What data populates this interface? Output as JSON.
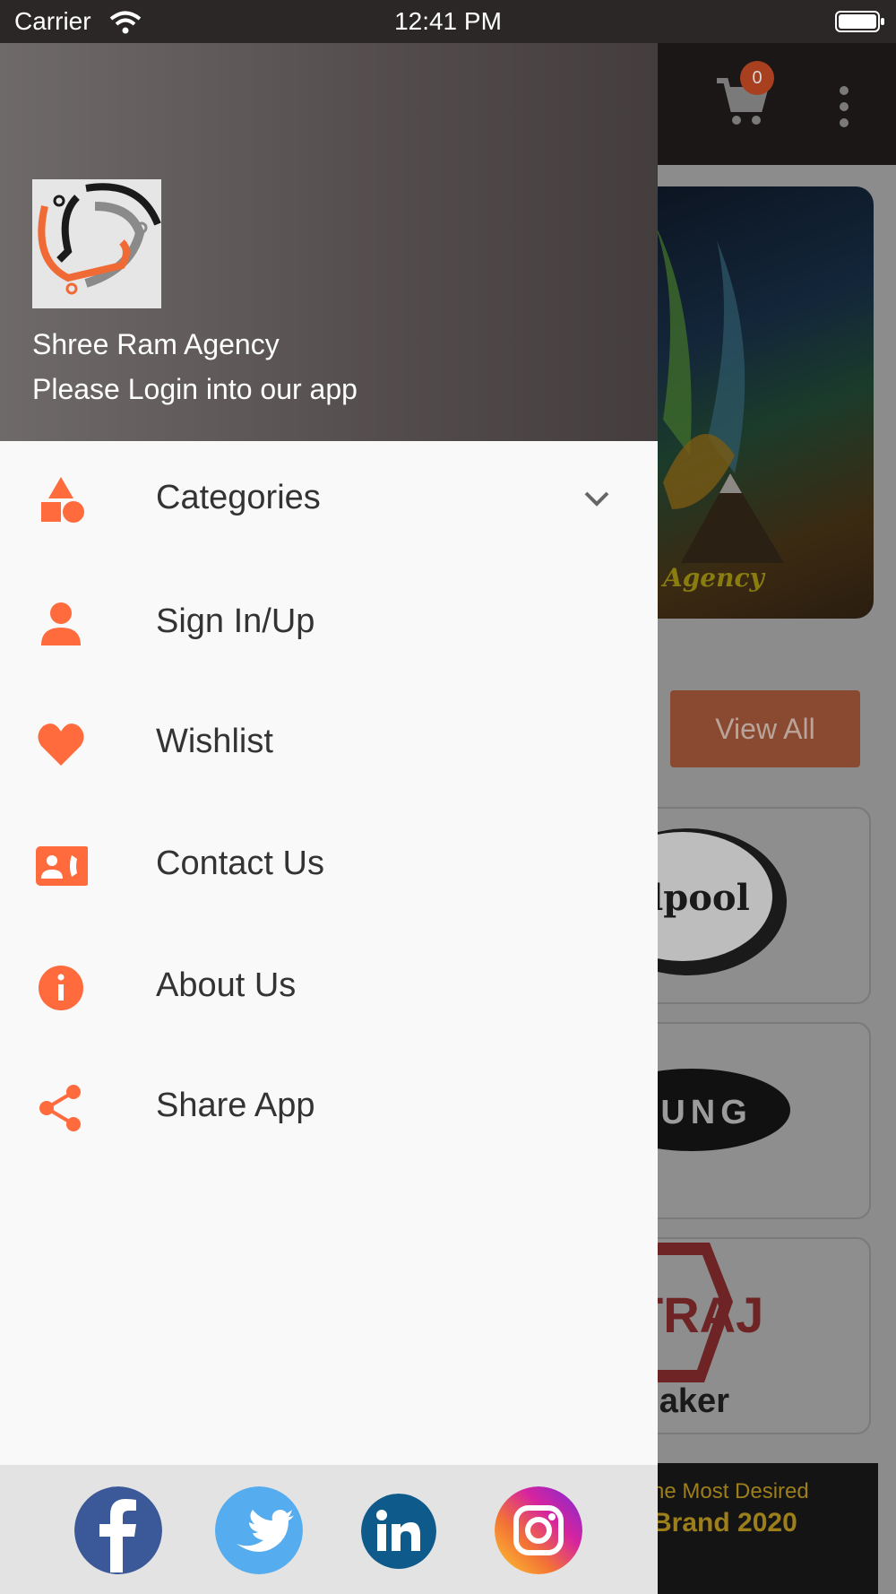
{
  "status_bar": {
    "carrier": "Carrier",
    "time": "12:41 PM"
  },
  "background_app": {
    "cart_count": "0",
    "banner_text": "Agency",
    "view_all_label": "View All",
    "brands": [
      "rlpool",
      "SUNG",
      "TRAJ",
      "maker"
    ],
    "bottom_banner": {
      "line1": "he Most Desired",
      "line2": "Brand 2020"
    }
  },
  "drawer": {
    "agency_name": "Shree Ram Agency",
    "login_prompt": "Please Login into our app",
    "menu": [
      {
        "label": "Categories",
        "icon": "categories-icon"
      },
      {
        "label": "Sign In/Up",
        "icon": "person-icon"
      },
      {
        "label": "Wishlist",
        "icon": "heart-icon"
      },
      {
        "label": "Contact Us",
        "icon": "contact-card-icon"
      },
      {
        "label": "About Us",
        "icon": "info-icon"
      },
      {
        "label": "Share App",
        "icon": "share-icon"
      }
    ],
    "social": [
      "facebook-icon",
      "twitter-icon",
      "linkedin-icon",
      "instagram-icon"
    ]
  },
  "colors": {
    "accent": "#ff6b3d",
    "facebook": "#3b5998",
    "twitter": "#55acee",
    "linkedin": "#0e5a8a"
  }
}
